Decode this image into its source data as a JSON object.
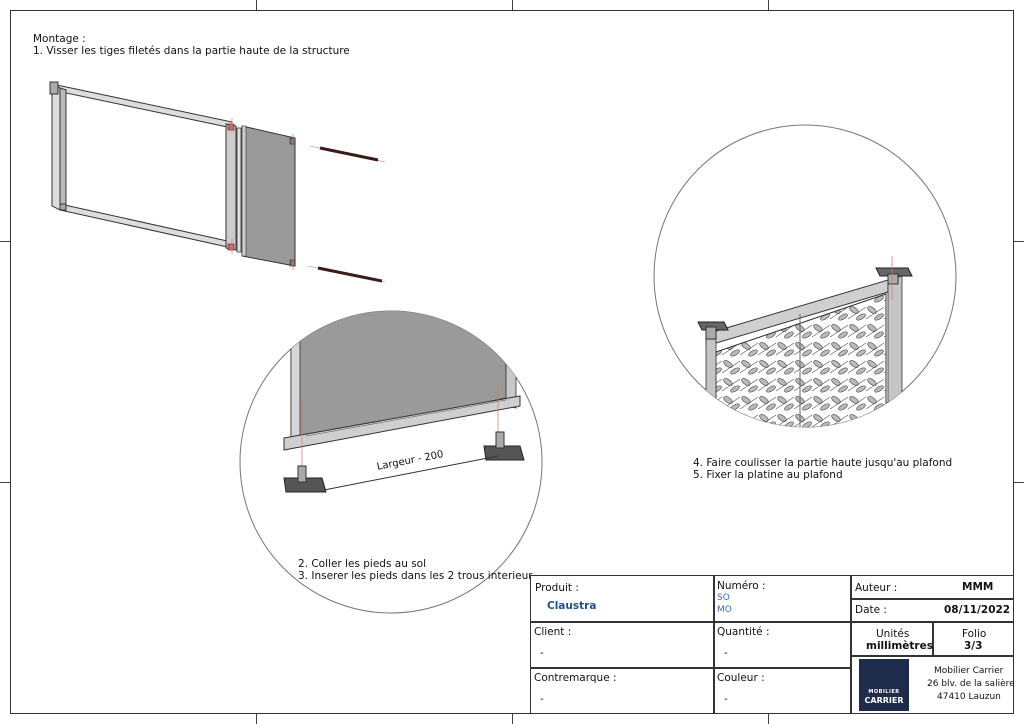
{
  "instructions": {
    "montage_title": "Montage :",
    "step1": "1. Visser les tiges filetés dans la partie haute de la structure",
    "step2": "2. Coller les pieds au sol",
    "step3": "3. Inserer les pieds dans les 2 trous interieur",
    "step4": "4. Faire coulisser la partie haute jusqu'au plafond",
    "step5": "5. Fixer la platine au plafond",
    "dimension_label": "Largeur - 200"
  },
  "title_block": {
    "produit_label": "Produit :",
    "produit_value": "Claustra",
    "numero_label": "Numéro :",
    "numero_line1": "SO",
    "numero_line2": "MO",
    "auteur_label": "Auteur :",
    "auteur_value": "MMM",
    "date_label": "Date :",
    "date_value": "08/11/2022",
    "client_label": "Client :",
    "client_value": "-",
    "quantite_label": "Quantité :",
    "quantite_value": "-",
    "unites_label": "Unités",
    "unites_value": "millimètres",
    "folio_label": "Folio",
    "folio_value": "3/3",
    "contremarque_label": "Contremarque :",
    "contremarque_value": "-",
    "couleur_label": "Couleur :",
    "couleur_value": "-",
    "logo_top": "MOBILIER",
    "logo_bottom": "CARRIER",
    "company_name": "Mobilier Carrier",
    "company_address1": "26 blv. de la salière",
    "company_address2": "47410 Lauzun"
  },
  "colors": {
    "panel_grey": "#9a9a9a",
    "logo_navy": "#1e2b4a",
    "accent_blue": "#1f4e8c"
  }
}
